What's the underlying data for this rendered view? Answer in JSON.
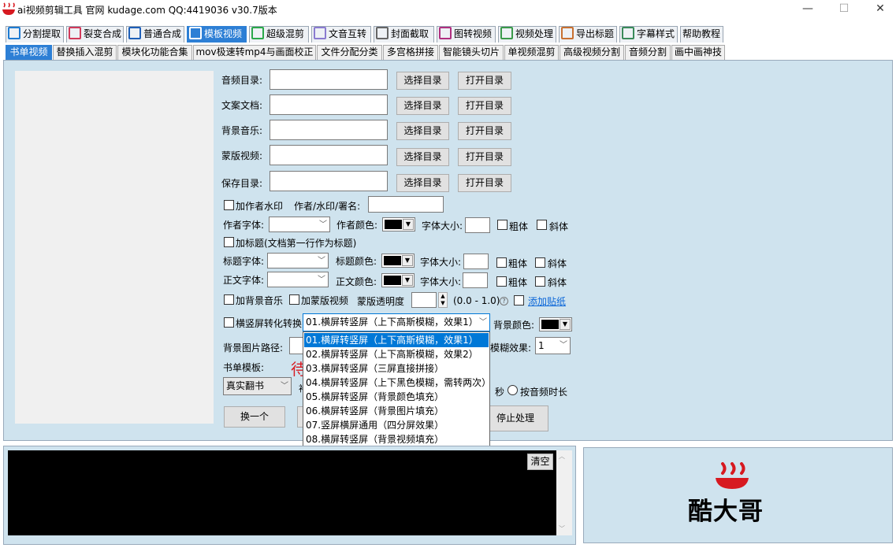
{
  "window": {
    "title": "ai视频剪辑工具 官网 kudage.com QQ:4419036   v30.7版本",
    "minimize": "—",
    "maximize": "☐",
    "close": "✕"
  },
  "main_tabs": [
    {
      "label": "分割提取",
      "icon": "play-icon",
      "color": "#1e7bd2"
    },
    {
      "label": "裂变合成",
      "icon": "layers-icon",
      "color": "#d23a5a"
    },
    {
      "label": "普通合成",
      "icon": "triangle-icon",
      "color": "#1e5fb8"
    },
    {
      "label": "模板视频",
      "icon": "template-icon",
      "color": "#ffffff"
    },
    {
      "label": "超级混剪",
      "icon": "waveform-icon",
      "color": "#2aa84a"
    },
    {
      "label": "文音互转",
      "icon": "microphone-icon",
      "color": "#8a7bd0"
    },
    {
      "label": "封面截取",
      "icon": "image-icon",
      "color": "#666666"
    },
    {
      "label": "图转视频",
      "icon": "slideshow-icon",
      "color": "#b03080"
    },
    {
      "label": "视频处理",
      "icon": "split-icon",
      "color": "#3a9a4a"
    },
    {
      "label": "导出标题",
      "icon": "export-icon",
      "color": "#c87030"
    },
    {
      "label": "字幕样式",
      "icon": "subtitle-icon",
      "color": "#3a8a5a"
    },
    {
      "label": "帮助教程",
      "icon": "",
      "color": ""
    }
  ],
  "sub_tabs": [
    "书单视频",
    "替换插入混剪",
    "模块化功能合集",
    "mov极速转mp4与画面校正",
    "文件分配分类",
    "多宫格拼接",
    "智能镜头切片",
    "单视频混剪",
    "高级视频分割",
    "音频分割",
    "画中画神技"
  ],
  "form": {
    "audio_dir": {
      "label": "音频目录:",
      "value": ""
    },
    "text_doc": {
      "label": "文案文档:",
      "value": ""
    },
    "bg_music": {
      "label": "背景音乐:",
      "value": ""
    },
    "mask_video": {
      "label": "蒙版视频:",
      "value": ""
    },
    "save_dir": {
      "label": "保存目录:",
      "value": ""
    },
    "select_dir": "选择目录",
    "open_dir": "打开目录",
    "add_author_watermark": "加作者水印",
    "author_watermark_label": "作者/水印/署名:",
    "author_watermark_value": "",
    "author_font": "作者字体:",
    "author_color": "作者颜色:",
    "font_size": "字体大小:",
    "bold": "粗体",
    "italic": "斜体",
    "add_title": "加标题(文档第一行作为标题)",
    "title_font": "标题字体:",
    "title_color": "标题颜色:",
    "body_font": "正文字体:",
    "body_color": "正文颜色:",
    "add_bg_music": "加背景音乐",
    "add_mask_video": "加蒙版视频",
    "mask_opacity": "蒙版透明度",
    "opacity_range": "(0.0 - 1.0)",
    "help_glyph": "?",
    "add_sticker": "添加贴纸",
    "orientation_convert": "横竖屏转化转换",
    "orientation_selected": "01.横屏转竖屏（上下高斯模糊，效果1）",
    "bg_color": "背景颜色:",
    "bg_image_path": "背景图片路径:",
    "blur_effect": "模糊效果:",
    "blur_value": "1",
    "book_template": "书单模板:",
    "book_template_value": "真实翻书",
    "waiting_partial": "待",
    "second_suffix": "秒",
    "by_audio_duration": "按音频时长",
    "swap_button": "换一个",
    "stop_button": "停止处理"
  },
  "orientation_options": [
    "01.横屏转竖屏（上下高斯模糊，效果1）",
    "02.横屏转竖屏（上下高斯模糊，效果2）",
    "03.横屏转竖屏（三屏直接拼接）",
    "04.横屏转竖屏（上下黑色模糊，需转两次）",
    "05.横屏转竖屏（背景颜色填充）",
    "06.横屏转竖屏（背景图片填充）",
    "07.竖屏横屏通用（四分屏效果）",
    "08.横屏转竖屏（背景视频填充）"
  ],
  "console": {
    "clear": "清空"
  },
  "brand": {
    "name": "酷大哥",
    "accent": "#d71920"
  }
}
